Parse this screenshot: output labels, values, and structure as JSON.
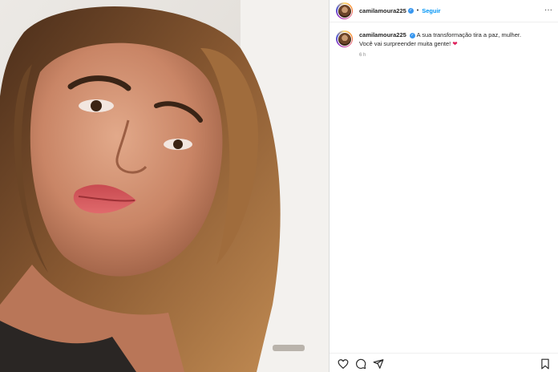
{
  "post": {
    "username": "camilamoura225",
    "follow_label": "Seguir",
    "separator": "•",
    "more_label": "···",
    "verified_mark": "✓"
  },
  "caption": {
    "username": "camilamoura225",
    "text_line1": "A sua transformação tira a paz, mulher.",
    "text_line2": "Você vai surpreender muita gente!",
    "emoji": "❤",
    "timestamp": "6 h"
  },
  "icons": {
    "verified": "verified-badge-icon",
    "like": "heart-icon",
    "comment": "comment-icon",
    "share": "share-icon",
    "save": "bookmark-icon"
  },
  "colors": {
    "accent": "#0095f6",
    "verified": "#3897f0",
    "heart": "#e0245e",
    "muted": "#8e8e8e"
  }
}
